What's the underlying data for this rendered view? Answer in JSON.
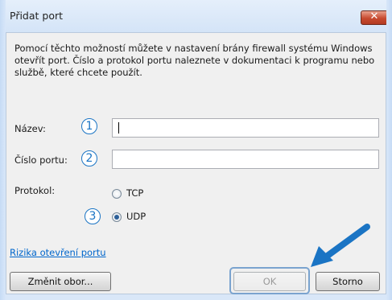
{
  "window": {
    "title": "Přidat port"
  },
  "description": "Pomocí těchto možností můžete v nastavení brány firewall systému Windows otevřít port. Číslo a protokol portu naleznete v dokumentaci k programu nebo službě, které chcete použít.",
  "fields": {
    "name_label": "Název:",
    "name_value": "",
    "port_label": "Číslo portu:",
    "port_value": ""
  },
  "protocol": {
    "label": "Protokol:",
    "options": [
      {
        "label": "TCP",
        "selected": false
      },
      {
        "label": "UDP",
        "selected": true
      }
    ]
  },
  "callouts": [
    "1",
    "2",
    "3"
  ],
  "link": "Rizika otevření portu",
  "buttons": {
    "change_scope": "Změnit obor...",
    "ok": "OK",
    "cancel": "Storno"
  },
  "colors": {
    "callout": "#1a74c4",
    "arrow": "#1a74c4",
    "close": "#c74a2f"
  },
  "icons": {
    "close": "close-icon",
    "arrow": "pointer-arrow-icon"
  }
}
